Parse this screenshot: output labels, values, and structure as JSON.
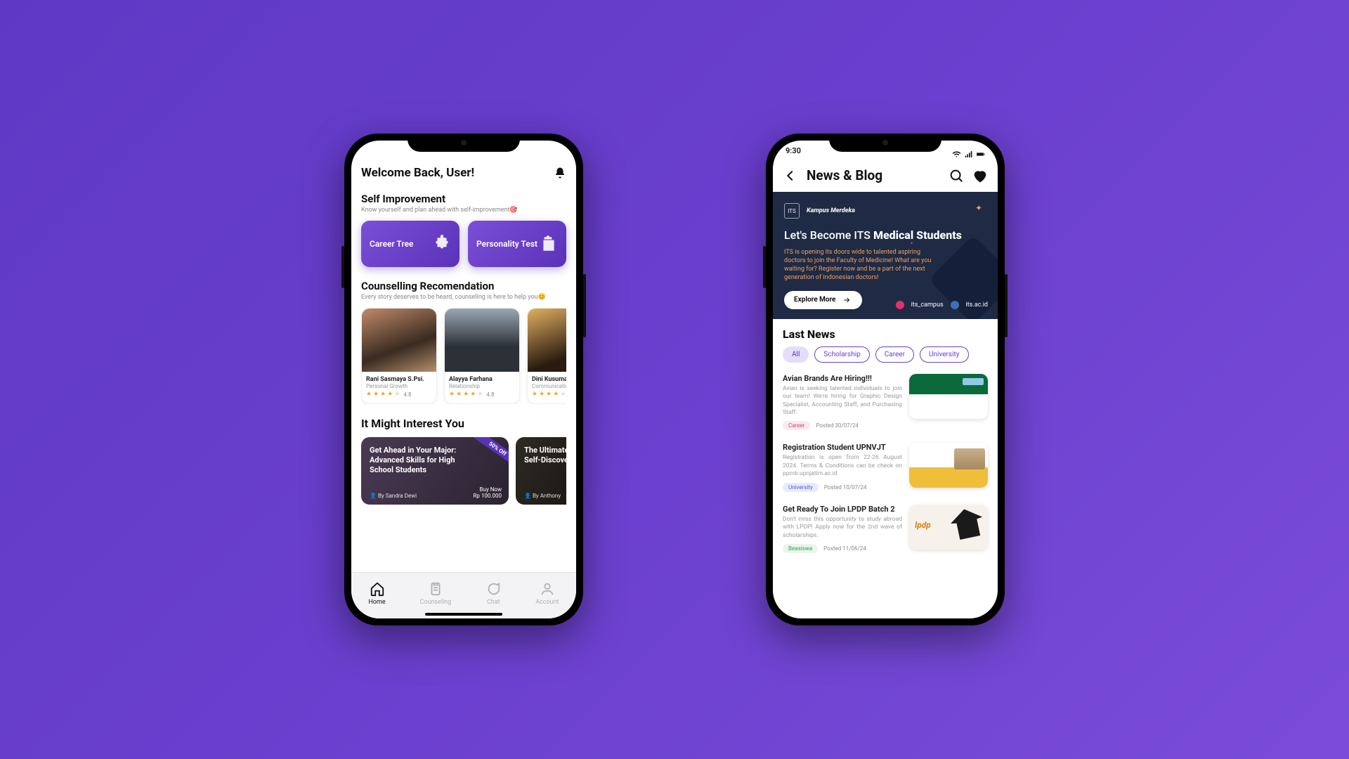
{
  "home": {
    "welcome": "Welcome Back, User!",
    "self": {
      "title": "Self Improvement",
      "subtitle": "Know yourself and plan ahead with self-improvement🎯",
      "tile1": "Career Tree",
      "tile2": "Personality Test"
    },
    "counsel": {
      "title": "Counselling Recomendation",
      "subtitle": "Every story deserves to be heard, counseling is here to help you😊",
      "cards": [
        {
          "name": "Rani Sasmaya S.Psi.",
          "tag": "Personal Growth",
          "rating": "4.8"
        },
        {
          "name": "Alayya Farhana",
          "tag": "Relationship",
          "rating": "4.8"
        },
        {
          "name": "Dini Kusuma",
          "tag": "Communication",
          "rating": ""
        }
      ]
    },
    "interest": {
      "title": "It Might Interest You",
      "c1": {
        "title": "Get Ahead in Your Major: Advanced Skills for High School Students",
        "by": "👤 By Sandra Dewi",
        "ribbon": "50% Off",
        "buy": "Buy Now",
        "price": "Rp 100.000"
      },
      "c2": {
        "title": "The Ultimate Self-Discove",
        "by": "👤 By Anthony"
      }
    },
    "tabs": {
      "home": "Home",
      "counseling": "Counseling",
      "chat": "Chat",
      "account": "Account"
    }
  },
  "news": {
    "clock": "9:30",
    "title": "News & Blog",
    "hero": {
      "logo1": "ITS",
      "logo2": "Kampus Merdeka",
      "titlePlain": "Let's Become ITS ",
      "titleBold": "Medical Students",
      "body": "ITS is opening its doors wide to talented aspiring doctors to join the Faculty of Medicine! What are you waiting for? Register now and be a part of the next generation of Indonesian doctors!",
      "button": "Explore More",
      "ig": "its_campus",
      "web": "its.ac.id"
    },
    "lastNews": "Last News",
    "chips": {
      "all": "All",
      "scholarship": "Scholarship",
      "career": "Career",
      "university": "University"
    },
    "items": [
      {
        "title": "Avian Brands Are Hiring!!!",
        "desc": "Avian is seeking talented individuals to join our team! We're hiring for Graphic Design Specialist, Accounting Staff, and Purchasing Staff.",
        "pill": "Career",
        "posted": "Posted 30/07/24",
        "pillClass": "career"
      },
      {
        "title": "Registration Student UPNVJT",
        "desc": "Registration is open from 22-26 August 2024. Terms & Conditions can be check on ppmb.upnjatim.ac.id",
        "pill": "University",
        "posted": "Posted 10/07/24",
        "pillClass": "univ"
      },
      {
        "title": "Get Ready To Join LPDP Batch 2",
        "desc": "Don't miss this opportunity to study abroad with LPDP! Apply now for the 2nd wave of scholarships.",
        "pill": "Beasiswa",
        "posted": "Posted 11/06/24",
        "pillClass": "beas"
      }
    ]
  }
}
